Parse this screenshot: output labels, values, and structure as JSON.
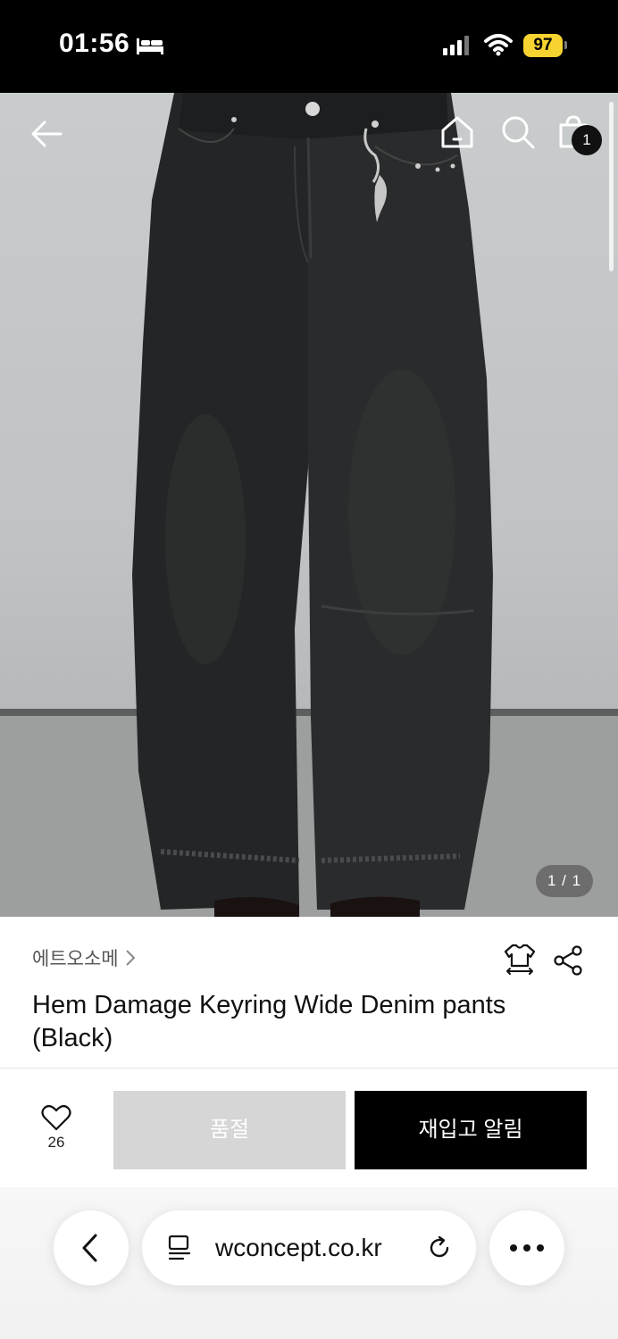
{
  "status_bar": {
    "time": "01:56",
    "battery": "97",
    "icons": [
      "bed-icon",
      "signal-icon",
      "wifi-icon",
      "battery-icon"
    ]
  },
  "hero": {
    "image_counter": "1 / 1",
    "cart_count": "1",
    "icons": [
      "back-arrow-icon",
      "home-icon",
      "search-icon",
      "shopping-bag-icon"
    ]
  },
  "product": {
    "brand": "에트오소메",
    "title": "Hem Damage Keyring Wide Denim pants (Black)",
    "icons": [
      "size-guide-icon",
      "share-icon"
    ]
  },
  "purchase_bar": {
    "like_count": "26",
    "soldout_label": "품절",
    "restock_label": "재입고 알림"
  },
  "browser": {
    "url": "wconcept.co.kr",
    "icons": [
      "chevron-left-icon",
      "page-menu-icon",
      "reload-icon",
      "more-icon"
    ]
  },
  "colors": {
    "status_bar_bg": "#000000",
    "battery": "#f6d330",
    "soldout_bg": "#d6d6d6",
    "restock_bg": "#000000"
  }
}
